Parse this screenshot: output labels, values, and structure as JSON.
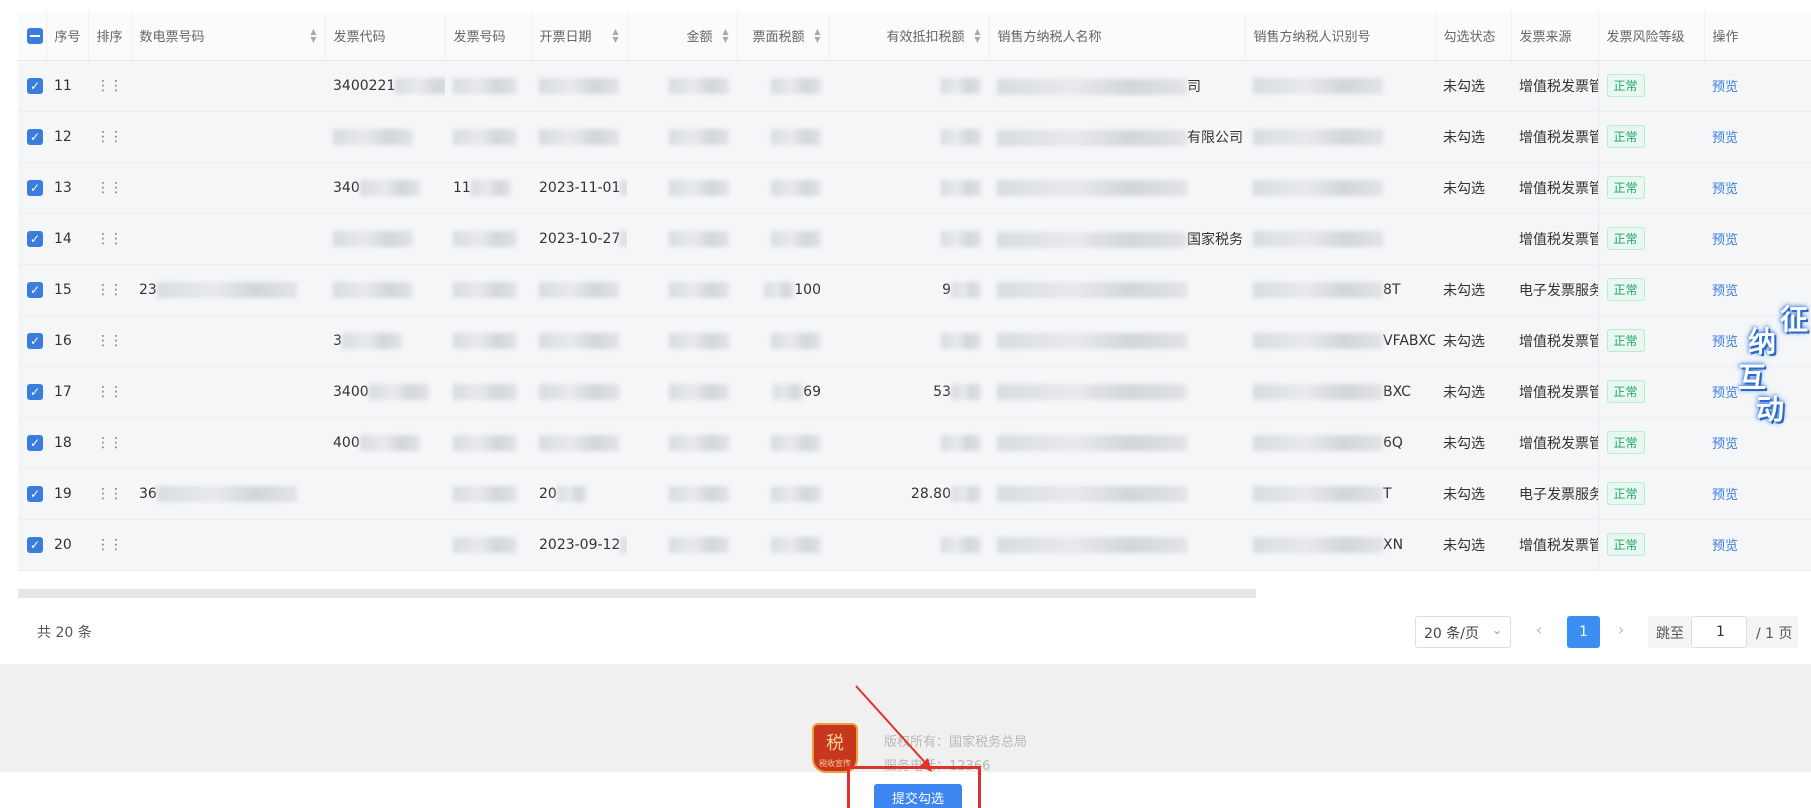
{
  "table": {
    "headers": {
      "index": "序号",
      "sort": "排序",
      "e_invoice_no": "数电票号码",
      "invoice_code": "发票代码",
      "invoice_no": "发票号码",
      "issue_date": "开票日期",
      "amount": "金额",
      "tax": "票面税额",
      "deductible_tax": "有效抵扣税额",
      "seller_name": "销售方纳税人名称",
      "seller_id": "销售方纳税人识别号",
      "check_status": "勾选状态",
      "source": "发票来源",
      "risk_level": "发票风险等级",
      "action": "操作"
    },
    "rows": [
      {
        "index": "11",
        "code": "3400221",
        "seller_name": "司",
        "id_suffix": "",
        "status": "未勾选",
        "source": "增值税发票管",
        "risk": "正常",
        "action": "预览"
      },
      {
        "index": "12",
        "code": "",
        "seller_name": "有限公司",
        "id_suffix": "",
        "status": "未勾选",
        "source": "增值税发票管",
        "risk": "正常",
        "action": "预览"
      },
      {
        "index": "13",
        "code": "340",
        "invoice_no": "11",
        "date": "2023-11-01",
        "seller_name": "",
        "id_suffix": "",
        "status": "未勾选",
        "source": "增值税发票管",
        "risk": "正常",
        "action": "预览"
      },
      {
        "index": "14",
        "code": "",
        "date": "2023-10-27",
        "seller_name": "国家税务",
        "id_suffix": "",
        "status": "",
        "source": "增值税发票管",
        "risk": "正常",
        "action": "预览"
      },
      {
        "index": "15",
        "e_no": "23",
        "code": "",
        "tax": "100",
        "deductible": "9",
        "seller_name": "",
        "id_suffix": "8T",
        "status": "未勾选",
        "source": "电子发票服务",
        "risk": "正常",
        "action": "预览"
      },
      {
        "index": "16",
        "code": "3",
        "seller_name": "",
        "id_suffix": "VFABXC",
        "status": "未勾选",
        "source": "增值税发票管",
        "risk": "正常",
        "action": "预览"
      },
      {
        "index": "17",
        "code": "3400",
        "tax": "69",
        "deductible": "53",
        "seller_name": "",
        "id_suffix": "BXC",
        "status": "未勾选",
        "source": "增值税发票管",
        "risk": "正常",
        "action": "预览"
      },
      {
        "index": "18",
        "code": "400",
        "seller_name": "",
        "id_suffix": "6Q",
        "status": "未勾选",
        "source": "增值税发票管",
        "risk": "正常",
        "action": "预览"
      },
      {
        "index": "19",
        "e_no": "36",
        "date": "20",
        "deductible": "28.80",
        "seller_name": "",
        "id_suffix": "T",
        "status": "未勾选",
        "source": "电子发票服务",
        "risk": "正常",
        "action": "预览"
      },
      {
        "index": "20",
        "date": "2023-09-12",
        "seller_name": "",
        "id_suffix": "XN",
        "status": "未勾选",
        "source": "增值税发票管",
        "risk": "正常",
        "action": "预览"
      }
    ]
  },
  "pagination": {
    "total": "共 20 条",
    "page_size": "20 条/页",
    "current_page": "1",
    "jump_label": "跳至",
    "jump_value": "1",
    "total_pages": "/ 1 页"
  },
  "footer": {
    "copyright": "版权所有：国家税务总局",
    "hotline": "服务电话：12366",
    "emblem_text": "税",
    "emblem_sub": "税收宣传"
  },
  "submit_button": "提交勾选",
  "mascot": {
    "chars": [
      "征",
      "纳",
      "互",
      "动"
    ]
  },
  "colors": {
    "primary": "#3b7ddd",
    "page_active": "#3b8ff2",
    "tag_green": "#1ea56a",
    "highlight_red": "#e0312a"
  }
}
